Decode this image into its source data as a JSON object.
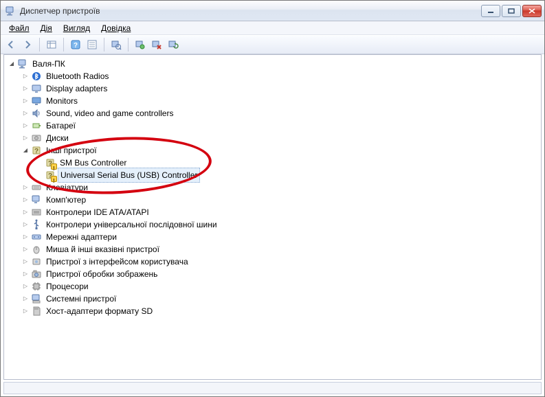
{
  "window": {
    "title": "Диспетчер пристроїв"
  },
  "menu": {
    "file": "Файл",
    "action": "Дія",
    "view": "Вигляд",
    "help": "Довідка"
  },
  "tree": {
    "root": "Валя-ПК",
    "items": [
      {
        "label": "Bluetooth Radios",
        "icon": "bluetooth"
      },
      {
        "label": "Display adapters",
        "icon": "display"
      },
      {
        "label": "Monitors",
        "icon": "monitor"
      },
      {
        "label": "Sound, video and game controllers",
        "icon": "sound"
      },
      {
        "label": "Батареї",
        "icon": "battery"
      },
      {
        "label": "Диски",
        "icon": "disk"
      },
      {
        "label": "Інші пристрої",
        "icon": "other",
        "expanded": true,
        "children": [
          {
            "label": "SM Bus Controller",
            "warn": true
          },
          {
            "label": "Universal Serial Bus (USB) Controller",
            "warn": true,
            "selected": true
          }
        ]
      },
      {
        "label": "Клавіатури",
        "icon": "keyboard"
      },
      {
        "label": "Комп'ютер",
        "icon": "computer"
      },
      {
        "label": "Контролери IDE ATA/ATAPI",
        "icon": "ide"
      },
      {
        "label": "Контролери універсальної послідовної шини",
        "icon": "usb"
      },
      {
        "label": "Мережні адаптери",
        "icon": "network"
      },
      {
        "label": "Миша й інші вказівні пристрої",
        "icon": "mouse"
      },
      {
        "label": "Пристрої з інтерфейсом користувача",
        "icon": "hid"
      },
      {
        "label": "Пристрої обробки зображень",
        "icon": "imaging"
      },
      {
        "label": "Процесори",
        "icon": "cpu"
      },
      {
        "label": "Системні пристрої",
        "icon": "system"
      },
      {
        "label": "Хост-адаптери формату SD",
        "icon": "sd"
      }
    ]
  }
}
